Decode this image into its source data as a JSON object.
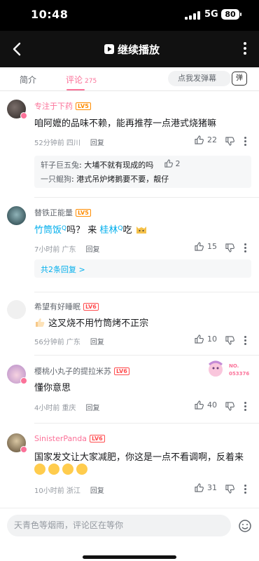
{
  "status": {
    "time": "10:48",
    "network": "5G",
    "battery": "80"
  },
  "video_bar": {
    "play_label": "继续播放",
    "icons": [
      "back-icon",
      "play-icon",
      "more-vertical-icon"
    ]
  },
  "tabs": {
    "intro": "简介",
    "comments": "评论",
    "comment_count": "275",
    "danmaku_placeholder": "点我发弹幕",
    "danmaku_toggle": "弹"
  },
  "comments": [
    {
      "username": "专注于下药",
      "level": "LV5",
      "text": "咱阿嬷的品味不赖，能再推荐一点港式烧猪嘛",
      "time": "52分钟前 四川",
      "reply": "回复",
      "likes": "22",
      "replies": [
        {
          "user": "轩子巨五兔",
          "text": ": 大埔不就有现成的吗",
          "likes": "2"
        },
        {
          "user": "一只鲲狗",
          "text": ": 港式吊炉烤鹅要不要，靓仔"
        }
      ]
    },
    {
      "username": "替铁正能量",
      "level": "LV5",
      "text_parts": [
        "竹筒饭",
        "吗？ 来 ",
        "桂林",
        "吃"
      ],
      "time": "7小时前 广东",
      "reply": "回复",
      "likes": "15",
      "more_replies": "共2条回复 >"
    },
    {
      "username": "希望有好睡眠",
      "level": "LV6",
      "text": "这叉烧不用竹筒烤不正宗",
      "time": "56分钟前 广东",
      "reply": "回复",
      "likes": "10"
    },
    {
      "username": "樱桃小丸子的提拉米苏",
      "level": "LV6",
      "text": "懂你意思",
      "time": "4小时前 重庆",
      "reply": "回复",
      "likes": "40",
      "decoration_text": "NO.",
      "decoration_number": "053376"
    },
    {
      "username": "SinisterPanda",
      "level": "LV6",
      "text": "国家发文让大家减肥，你这是一点不看调啊，反着来",
      "time": "10小时前 浙江",
      "reply": "回复",
      "likes": "31"
    }
  ],
  "bottom": {
    "input_placeholder": "天青色等烟雨，评论区在等你"
  },
  "colors": {
    "accent": "#fb7299",
    "link": "#00aeec",
    "lv5": "#ff8c00",
    "lv6": "#ff4d4f"
  }
}
